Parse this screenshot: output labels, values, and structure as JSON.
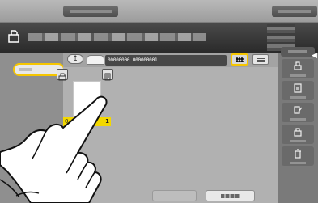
{
  "header": {
    "icon": "document-box-icon"
  },
  "main": {
    "toolbar": {
      "up_symbol": "↥",
      "path": "00000000  000000001"
    },
    "thumbnail": {
      "label_left": "0",
      "label_right": "1"
    }
  },
  "colors": {
    "selection": "#f6c600",
    "header_dark": "#2a2a2a",
    "thumb_label": "#f3d800"
  },
  "right_buttons": {
    "icons": [
      "print-icon",
      "save-icon",
      "edit-icon",
      "delete-box-icon",
      "trash-icon"
    ]
  }
}
